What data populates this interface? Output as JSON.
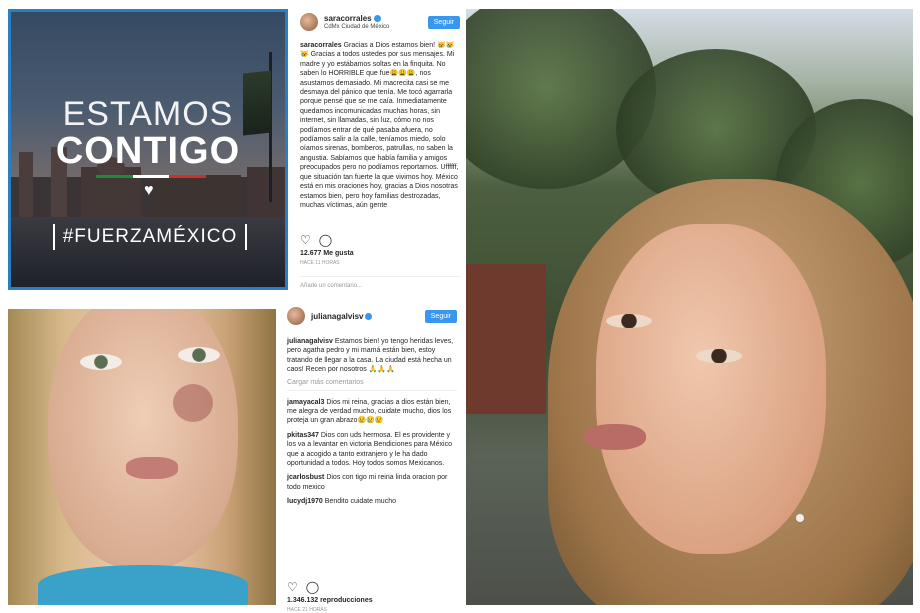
{
  "contigo": {
    "line1": "ESTAMOS",
    "line2": "CONTIGO",
    "hashtag": "#FUERZAMÉXICO",
    "tricolor": [
      "#1f8a3b",
      "#ffffff",
      "#d52b2b"
    ],
    "frame_color": "#2a7fc4"
  },
  "post_sara": {
    "username": "saracorrales",
    "location": "CdMx Ciudad de México",
    "follow_label": "Seguir",
    "caption_user": "saracorrales",
    "caption_text": "Gracias a Dios estamos bien! 😿😿😿 Gracias a todos ustedes por sus mensajes. Mi madre y yo estábamos soltas en la finquita. No saben lo HORRIBLE que fue😩😩😩, nos asustamos demasiado. Mi macrecita casi se me desmaya del pánico que tenía. Me tocó agarrarla porque pensé que se me caía. Inmediatamente quedamos incomunicadas muchas horas, sin internet, sin llamadas, sin luz, cómo no nos podíamos entrar de qué pasaba afuera, no podíamos salir a la calle, teníamos miedo, solo oíamos sirenas, bomberos, patrullas, no saben la angustia. Sabíamos que había familia y amigos preocupados pero no podíamos reportarnos. Uffffff, que situación tan fuerte la que vivimos hoy. México está en mis oraciones hoy, gracias a Dios nosotras estamos bien, pero hoy familias destrozadas, muchas víctimas, aún gente",
    "likes": "12.677 Me gusta",
    "date": "HACE 11 HORAS",
    "add_comment_placeholder": "Añade un comentario..."
  },
  "post_juliana": {
    "username": "julianagalvisv",
    "follow_label": "Seguir",
    "caption_user": "julianagalvisv",
    "caption_text": "Estamos bien! yo tengo heridas leves, pero agatha pedro y mi mamá están bien, estoy tratando de llegar a la casa. La ciudad está hecha un caos! Recen por nosotros 🙏🙏🙏",
    "load_more": "Cargar más comentarios",
    "comments": [
      {
        "user": "jamayacal3",
        "text": "Dios mi reina, gracias a dios están bien, me alegra de verdad mucho, cuidate mucho, dios los proteja un gran abrazo😢😢😢"
      },
      {
        "user": "pkitas347",
        "text": "Dios con uds hermosa. El es providente y los va a levantar en victoria Bendiciones para México que a acogido a tanto extranjero y le ha dado oportunidad a todos. Hoy todos somos Mexicanos."
      },
      {
        "user": "jcarlosbust",
        "text": "Dios con tigo mi reina linda oracion por todo mexico"
      },
      {
        "user": "lucydj1970",
        "text": "Bendito cuidate mucho"
      }
    ],
    "reproductions": "1.346.132 reproducciones",
    "date": "HACE 21 HORAS"
  }
}
